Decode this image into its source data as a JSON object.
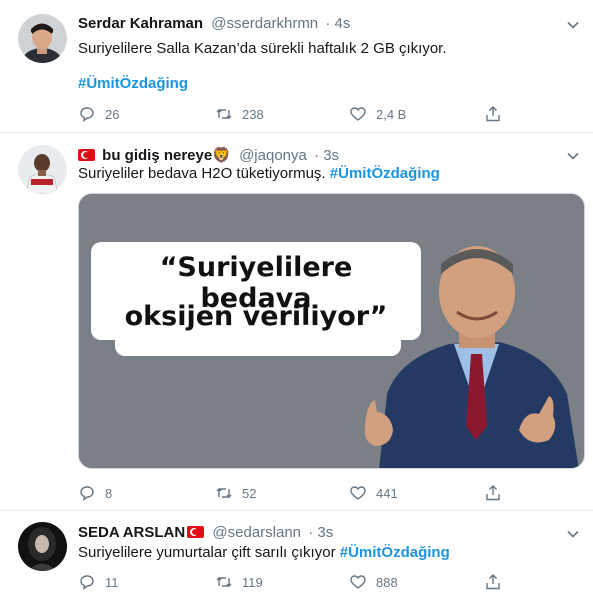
{
  "tweets": [
    {
      "name": "Serdar Kahraman",
      "handle": "@sserdarkhrmn",
      "time": "· 4s",
      "text": "Suriyelilere Salla Kazan’da sürekli haftalık 2 GB çıkıyor.",
      "hashtag": "#ÜmitÖzdağing",
      "replies": "26",
      "retweets": "238",
      "likes": "2,4 B"
    },
    {
      "name": "bu gidiş nereye",
      "name_emoji": "🦁",
      "handle": "@jaqonya",
      "time": "· 3s",
      "text": "Suriyeliler bedava H2O tüketiyormuş.",
      "hashtag": "#ÜmitÖzdağing",
      "quote_line1": "“Suriyelilere bedava",
      "quote_line2": "oksijen veriliyor”",
      "replies": "8",
      "retweets": "52",
      "likes": "441"
    },
    {
      "name": "SEDA ARSLAN",
      "handle": "@sedarslann",
      "time": "· 3s",
      "text": "Suriyelilere yumurtalar çift sarılı çıkıyor",
      "hashtag": "#ÜmitÖzdağing",
      "replies": "11",
      "retweets": "119",
      "likes": "888"
    }
  ],
  "colors": {
    "accent": "#1b95e0",
    "muted": "#657786",
    "border": "#e6ecf0"
  },
  "icons": [
    "reply-icon",
    "retweet-icon",
    "like-icon",
    "share-icon",
    "chevron-down-icon",
    "turkish-flag-icon",
    "lion-emoji"
  ]
}
